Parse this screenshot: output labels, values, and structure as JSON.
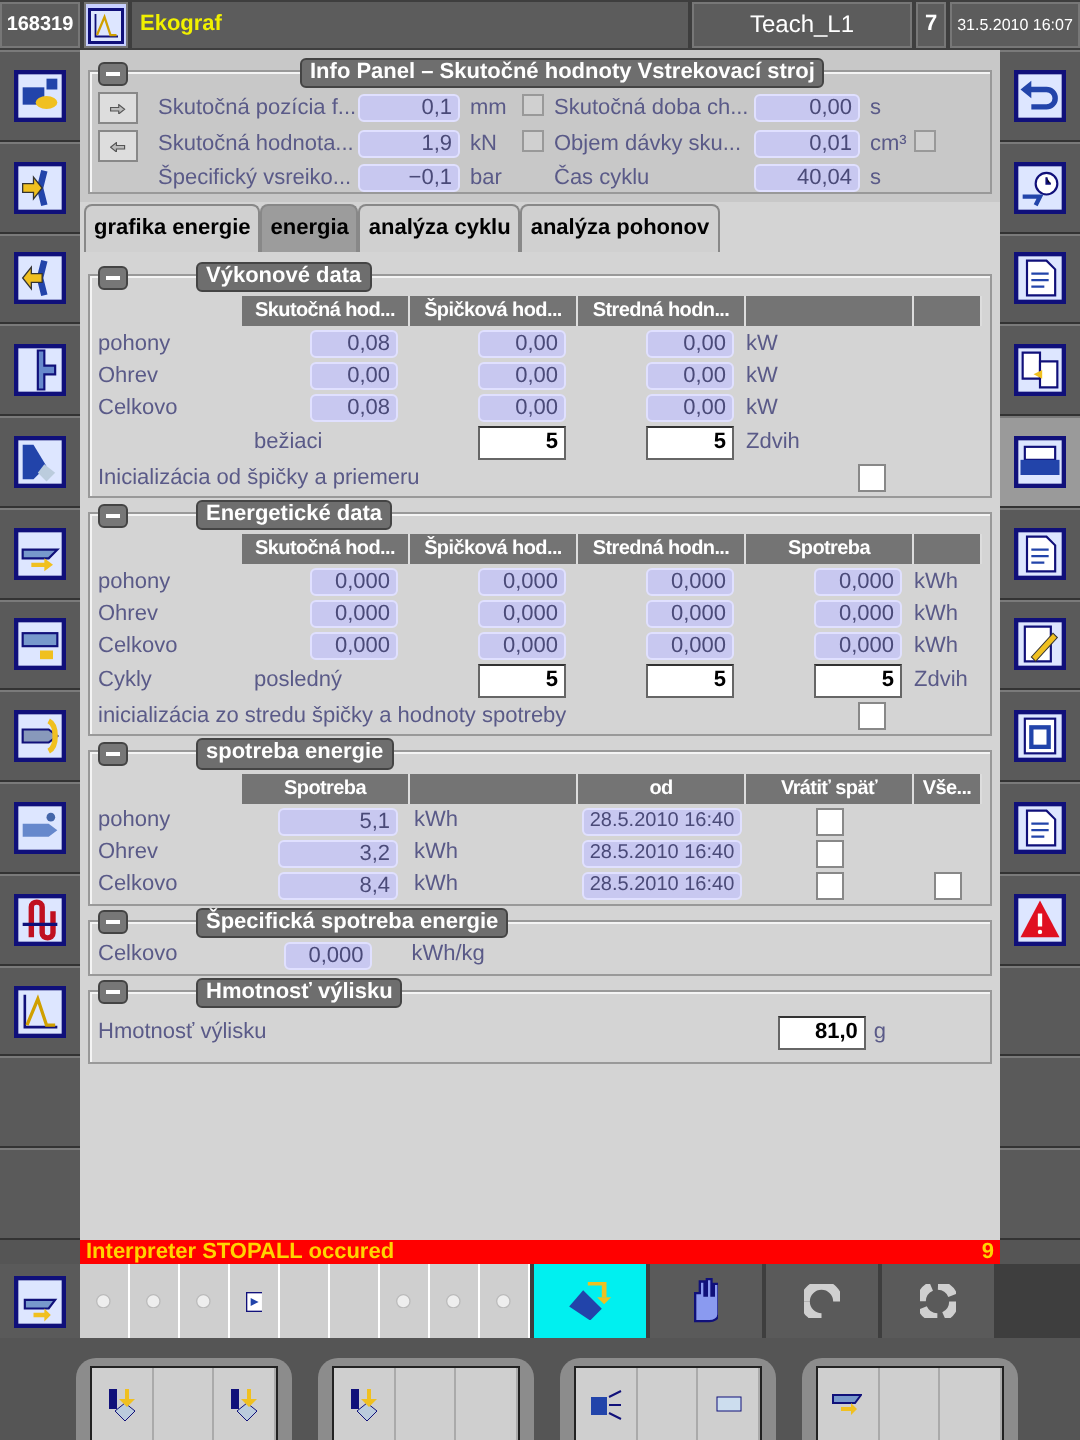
{
  "header": {
    "machine_number": "168319",
    "title": "Ekograf",
    "user": "Teach_L1",
    "access_level": "7",
    "datetime": "31.5.2010 16:07"
  },
  "info_panel": {
    "title": "Info Panel – Skutočné hodnoty Vstrekovací stroj",
    "rows": [
      {
        "left": {
          "label": "Skutočná pozícia f...",
          "value": "0,1",
          "unit": "mm",
          "checkbox": {
            "checked": false
          }
        },
        "right": {
          "label": "Skutočná doba ch...",
          "value": "0,00",
          "unit": "s"
        }
      },
      {
        "left": {
          "label": "Skutočná hodnota...",
          "value": "1,9",
          "unit": "kN",
          "checkbox": {
            "checked": false
          }
        },
        "right": {
          "label": "Objem dávky sku...",
          "value": "0,01",
          "unit": "cm³",
          "checkbox": {
            "checked": false
          }
        }
      },
      {
        "left": {
          "label": "Špecifický vsreiko...",
          "value": "−0,1",
          "unit": "bar"
        },
        "right": {
          "label": "Čas cyklu",
          "value": "40,04",
          "unit": "s"
        }
      }
    ]
  },
  "tabs": [
    {
      "label": "grafika energie",
      "selected": false
    },
    {
      "label": "energia",
      "selected": true
    },
    {
      "label": "analýza cyklu",
      "selected": false
    },
    {
      "label": "analýza pohonov",
      "selected": false
    }
  ],
  "sections": [
    {
      "kind": "table",
      "title": "Výkonové data",
      "columns": [
        "Skutočná hod...",
        "Špičková hod...",
        "Stredná hodn..."
      ],
      "rows": [
        {
          "label": "pohony",
          "values": [
            "0,08",
            "0,00",
            "0,00"
          ],
          "unit": "kW"
        },
        {
          "label": "Ohrev",
          "values": [
            "0,00",
            "0,00",
            "0,00"
          ],
          "unit": "kW"
        },
        {
          "label": "Celkovo",
          "values": [
            "0,08",
            "0,00",
            "0,00"
          ],
          "unit": "kW"
        }
      ],
      "cycles": {
        "caption": "bežiaci",
        "inputs": [
          "5",
          "5"
        ],
        "unit": "Zdvih"
      },
      "reset": {
        "text": "Inicializácia od špičky a priemeru",
        "checked": false
      }
    },
    {
      "kind": "table",
      "title": "Energetické data",
      "columns": [
        "Skutočná hod...",
        "Špičková hod...",
        "Stredná hodn...",
        "Spotreba"
      ],
      "rows": [
        {
          "label": "pohony",
          "values": [
            "0,000",
            "0,000",
            "0,000",
            "0,000"
          ],
          "unit": "kWh"
        },
        {
          "label": "Ohrev",
          "values": [
            "0,000",
            "0,000",
            "0,000",
            "0,000"
          ],
          "unit": "kWh"
        },
        {
          "label": "Celkovo",
          "values": [
            "0,000",
            "0,000",
            "0,000",
            "0,000"
          ],
          "unit": "kWh"
        }
      ],
      "cycles": {
        "label": "Cykly",
        "caption": "posledný",
        "inputs": [
          "5",
          "5",
          "5"
        ],
        "unit": "Zdvih"
      },
      "reset": {
        "text": "inicializácia zo stredu špičky a hodnoty spotreby",
        "checked": false
      }
    },
    {
      "kind": "consumption",
      "title": "spotreba energie",
      "columns": [
        "Spotreba",
        "od",
        "Vrátiť späť",
        "Vše..."
      ],
      "rows": [
        {
          "label": "pohony",
          "value": "5,1",
          "unit": "kWh",
          "since": "28.5.2010 16:40",
          "revert": {
            "checked": false
          }
        },
        {
          "label": "Ohrev",
          "value": "3,2",
          "unit": "kWh",
          "since": "28.5.2010 16:40",
          "revert": {
            "checked": false
          }
        },
        {
          "label": "Celkovo",
          "value": "8,4",
          "unit": "kWh",
          "since": "28.5.2010 16:40",
          "revert": {
            "checked": false
          },
          "all": {
            "checked": false
          }
        }
      ]
    },
    {
      "kind": "single",
      "title": "Špecifická spotreba energie",
      "label": "Celkovo",
      "value": "0,000",
      "unit": "kWh/kg",
      "editable": false
    },
    {
      "kind": "single",
      "title": "Hmotnosť výlisku",
      "label": "Hmotnosť výlisku",
      "value": "81,0",
      "unit": "g",
      "editable": true
    }
  ],
  "status": {
    "message": "Interpreter STOPALL occured",
    "count": "9"
  },
  "mode_buttons": [
    {
      "selected": true
    },
    {
      "selected": false
    },
    {
      "selected": false
    },
    {
      "selected": false
    }
  ]
}
